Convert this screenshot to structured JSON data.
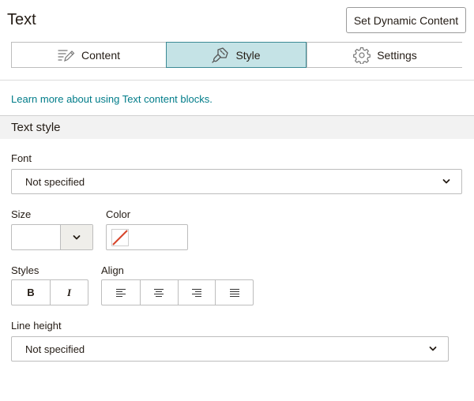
{
  "header": {
    "title": "Text",
    "dynamic_button_label": "Set Dynamic Content"
  },
  "tabs": [
    {
      "label": "Content",
      "icon": "content-edit-icon",
      "active": false
    },
    {
      "label": "Style",
      "icon": "style-brush-icon",
      "active": true
    },
    {
      "label": "Settings",
      "icon": "settings-gear-icon",
      "active": false
    }
  ],
  "learn_more_link": "Learn more about using Text content blocks.",
  "text_style": {
    "section_title": "Text style",
    "font": {
      "label": "Font",
      "value": "Not specified"
    },
    "size": {
      "label": "Size",
      "value": ""
    },
    "color": {
      "label": "Color",
      "value": "none"
    },
    "styles": {
      "label": "Styles",
      "bold": "B",
      "italic": "I"
    },
    "align": {
      "label": "Align",
      "options": [
        "left",
        "center",
        "right",
        "justify"
      ]
    },
    "line_height": {
      "label": "Line height",
      "value": "Not specified"
    }
  },
  "colors": {
    "accent": "#007c89",
    "active_tab_bg": "#c5e3e6",
    "active_tab_border": "#3c8a95",
    "no_color_slash": "#d6452a"
  }
}
